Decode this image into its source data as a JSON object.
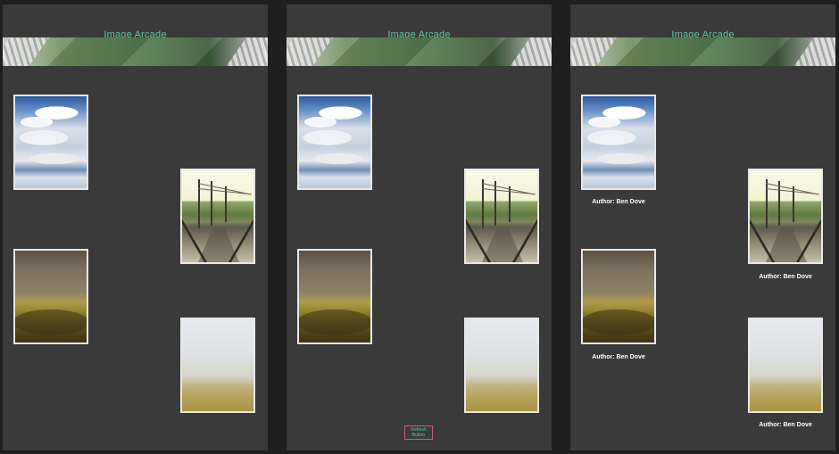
{
  "app": {
    "title": "Image Arcade"
  },
  "panels": [
    {
      "id": "panel-1",
      "images": [
        {
          "name": "clouds"
        },
        {
          "name": "railway"
        },
        {
          "name": "hill"
        },
        {
          "name": "fog"
        }
      ]
    },
    {
      "id": "panel-2",
      "images": [
        {
          "name": "clouds"
        },
        {
          "name": "railway"
        },
        {
          "name": "hill"
        },
        {
          "name": "fog"
        }
      ],
      "refresh_button": {
        "label": "Refresh\nButton"
      }
    },
    {
      "id": "panel-3",
      "images": [
        {
          "name": "clouds",
          "author": "Author: Ben Dove"
        },
        {
          "name": "railway",
          "author": "Author: Ben Dove"
        },
        {
          "name": "hill",
          "author": "Author: Ben Dove"
        },
        {
          "name": "fog",
          "author": "Author: Ben Dove"
        }
      ]
    }
  ],
  "colors": {
    "title": "#5fc79a",
    "panel_bg": "#3a3a3a",
    "page_bg": "#1f1f1f",
    "refresh_border": "#c85a8c"
  }
}
